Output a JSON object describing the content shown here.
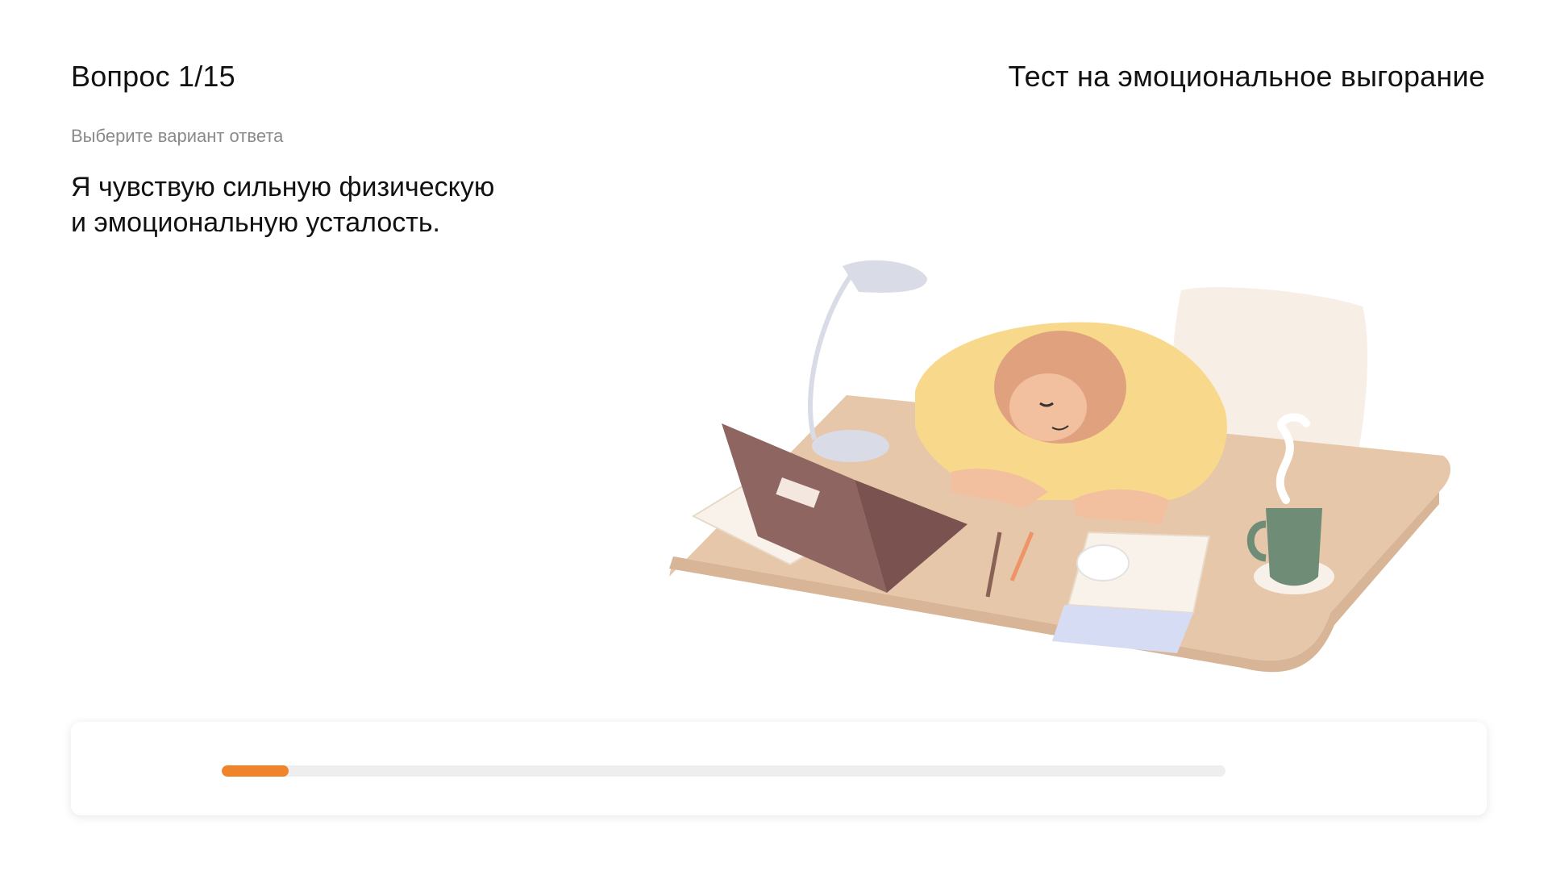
{
  "header": {
    "question_counter": "Вопрос 1/15",
    "test_title": "Тест на эмоциональное выгорание"
  },
  "main": {
    "hint": "Выберите вариант ответа",
    "question_lines": [
      "Я чувствую сильную физическую",
      "и эмоциональную усталость."
    ],
    "illustration": "tired-person-at-desk-illustration"
  },
  "progress": {
    "current": 1,
    "total": 15,
    "fraction": 0.0667
  },
  "colors": {
    "accent": "#f0842a",
    "track": "#eeeeee",
    "hint_text": "#8a8a8a",
    "text": "#111111"
  }
}
